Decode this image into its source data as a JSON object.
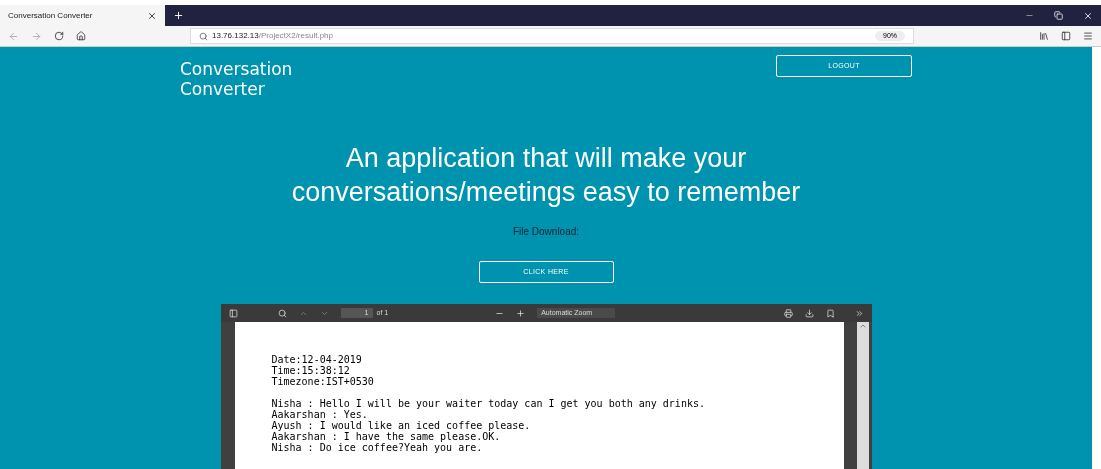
{
  "browser": {
    "tab_title": "Conversation Converter",
    "address_host": "13.76.132.13",
    "address_path": "/ProjectX2/result.php",
    "zoom": "90%"
  },
  "header": {
    "logo_lines": [
      "Conversation",
      "Converter"
    ],
    "logout": "LOGOUT"
  },
  "hero": {
    "heading_lines": [
      "An application that will make your",
      "conversations/meetings easy to remember"
    ],
    "download_label": "File Download:",
    "download_button": "CLICK HERE"
  },
  "pdf_viewer": {
    "page_number": "1",
    "page_count": "of 1",
    "zoom": "Automatic Zoom",
    "paragraphs": [
      [
        "Date:12-04-2019",
        "Time:15:38:12",
        "Timezone:IST+0530"
      ],
      [
        "Nisha : Hello I will be your waiter today can I get you both any drinks.",
        "Aakarshan : Yes.",
        "Ayush : I would like an iced coffee please.",
        "Aakarshan : I have the same please.OK.",
        "Nisha : Do ice coffee?Yeah you are."
      ]
    ]
  }
}
